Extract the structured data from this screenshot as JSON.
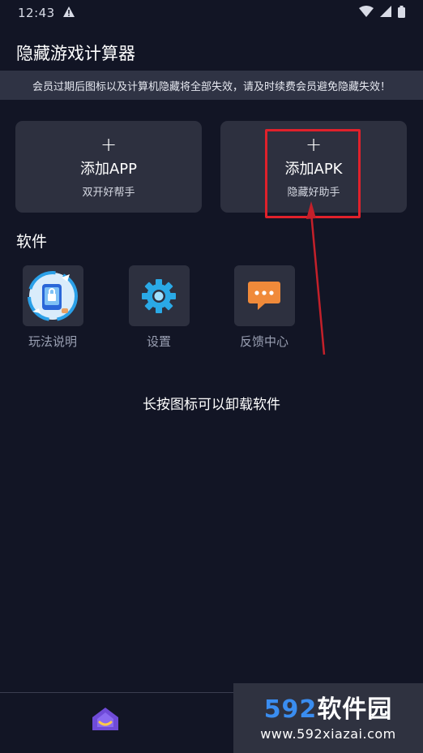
{
  "status": {
    "time": "12:43"
  },
  "header": {
    "title": "隐藏游戏计算器"
  },
  "notice": {
    "text": "会员过期后图标以及计算机隐藏将全部失效，请及时续费会员避免隐藏失效！"
  },
  "add_cards": [
    {
      "plus": "+",
      "title": "添加APP",
      "subtitle": "双开好帮手"
    },
    {
      "plus": "+",
      "title": "添加APK",
      "subtitle": "隐藏好助手"
    }
  ],
  "section": {
    "title": "软件"
  },
  "apps": [
    {
      "label": "玩法说明",
      "icon": "tutorial-icon"
    },
    {
      "label": "设置",
      "icon": "gear-icon"
    },
    {
      "label": "反馈中心",
      "icon": "chat-bubble-icon"
    }
  ],
  "hint": {
    "text": "长按图标可以卸载软件"
  },
  "watermark": {
    "brand_num": "592",
    "brand_text": "软件园",
    "url": "www.592xiazai.com"
  },
  "colors": {
    "background": "#121525",
    "card": "#2d303f",
    "highlight": "#e0212b",
    "accent_blue": "#3a8df0",
    "home_purple": "#6f4bd8"
  }
}
